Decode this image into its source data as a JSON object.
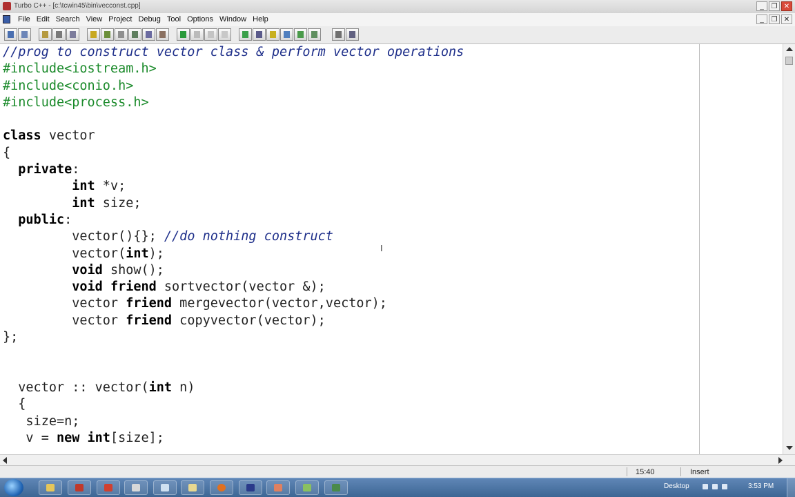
{
  "window": {
    "title": "Turbo C++ - [c:\\tcwin45\\bin\\vecconst.cpp]",
    "minimize": "_",
    "restore": "❐",
    "close": "✕"
  },
  "menu": {
    "items": [
      "File",
      "Edit",
      "Search",
      "View",
      "Project",
      "Debug",
      "Tool",
      "Options",
      "Window",
      "Help"
    ]
  },
  "editor": {
    "lines": [
      [
        {
          "t": "//prog to construct vector class & perform vector operations",
          "c": "comment"
        }
      ],
      [
        {
          "t": "#include<iostream.h>",
          "c": "pre"
        }
      ],
      [
        {
          "t": "#include<conio.h>",
          "c": "pre"
        }
      ],
      [
        {
          "t": "#include<process.h>",
          "c": "pre"
        }
      ],
      [],
      [
        {
          "t": "class",
          "c": "kw"
        },
        {
          "t": " vector"
        }
      ],
      [
        {
          "t": "{"
        }
      ],
      [
        {
          "t": "  "
        },
        {
          "t": "private",
          "c": "kw"
        },
        {
          "t": ":"
        }
      ],
      [
        {
          "t": "         "
        },
        {
          "t": "int",
          "c": "kw"
        },
        {
          "t": " *v;"
        }
      ],
      [
        {
          "t": "         "
        },
        {
          "t": "int",
          "c": "kw"
        },
        {
          "t": " size;"
        }
      ],
      [
        {
          "t": "  "
        },
        {
          "t": "public",
          "c": "kw"
        },
        {
          "t": ":"
        }
      ],
      [
        {
          "t": "         vector(){}; "
        },
        {
          "t": "//do nothing construct",
          "c": "comment"
        }
      ],
      [
        {
          "t": "         vector("
        },
        {
          "t": "int",
          "c": "kw"
        },
        {
          "t": ");"
        }
      ],
      [
        {
          "t": "         "
        },
        {
          "t": "void",
          "c": "kw"
        },
        {
          "t": " show();"
        }
      ],
      [
        {
          "t": "         "
        },
        {
          "t": "void",
          "c": "kw"
        },
        {
          "t": " "
        },
        {
          "t": "friend",
          "c": "kw"
        },
        {
          "t": " sortvector(vector &);"
        }
      ],
      [
        {
          "t": "         vector "
        },
        {
          "t": "friend",
          "c": "kw"
        },
        {
          "t": " mergevector(vector,vector);"
        }
      ],
      [
        {
          "t": "         vector "
        },
        {
          "t": "friend",
          "c": "kw"
        },
        {
          "t": " copyvector(vector);"
        }
      ],
      [
        {
          "t": "};"
        }
      ],
      [],
      [],
      [
        {
          "t": "  vector :: vector("
        },
        {
          "t": "int",
          "c": "kw"
        },
        {
          "t": " n)"
        }
      ],
      [
        {
          "t": "  {"
        }
      ],
      [
        {
          "t": "   size=n;"
        }
      ],
      [
        {
          "t": "   v = "
        },
        {
          "t": "new",
          "c": "kw"
        },
        {
          "t": " "
        },
        {
          "t": "int",
          "c": "kw"
        },
        {
          "t": "[size];"
        }
      ]
    ]
  },
  "status": {
    "position": "15:40",
    "mode": "Insert"
  },
  "taskbar": {
    "desktop_label": "Desktop",
    "clock": "3:53 PM"
  },
  "colors": {
    "comment": "#1e2f8a",
    "preprocessor": "#1a8a2a",
    "keyword": "#000000"
  }
}
